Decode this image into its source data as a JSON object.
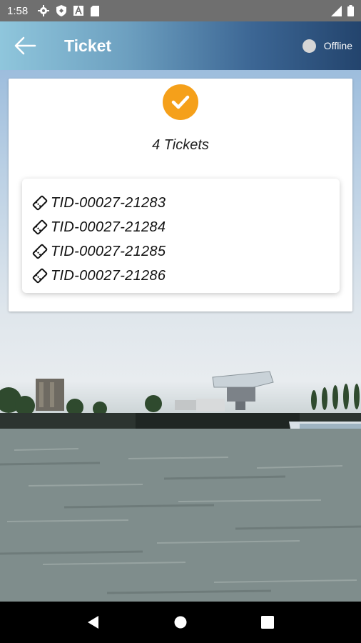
{
  "status_bar": {
    "time": "1:58"
  },
  "app_bar": {
    "title": "Ticket",
    "offline_label": "Offline"
  },
  "summary": {
    "count_label": "4 Tickets"
  },
  "tickets": [
    {
      "id": "TID-00027-21283"
    },
    {
      "id": "TID-00027-21284"
    },
    {
      "id": "TID-00027-21285"
    },
    {
      "id": "TID-00027-21286"
    }
  ],
  "colors": {
    "accent": "#f5a01a",
    "app_bar_start": "#8fc6dc",
    "app_bar_end": "#23446d"
  },
  "icons": {
    "back": "arrow-left-icon",
    "check": "check-icon",
    "ticket": "ticket-icon"
  }
}
